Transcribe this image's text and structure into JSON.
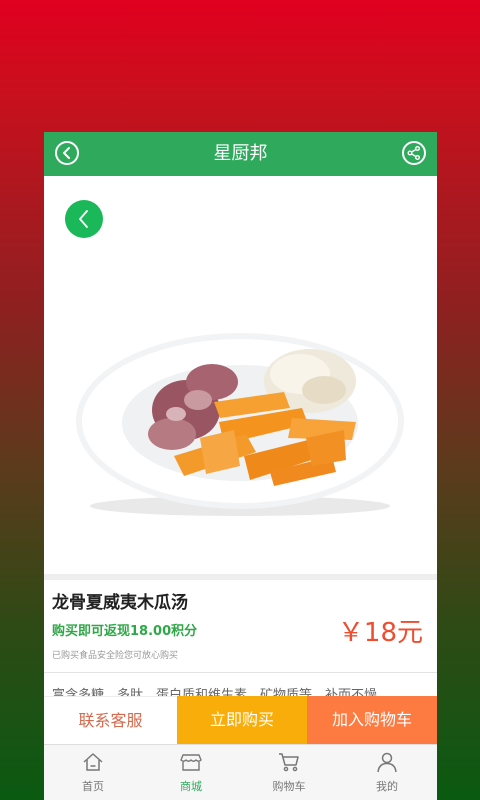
{
  "header": {
    "title": "星厨邦"
  },
  "product": {
    "name": "龙骨夏威夷木瓜汤",
    "rebate": "购买即可返现18.00积分",
    "notice": "已购买食品安全险您可放心购买",
    "price": "￥18元",
    "description": "富含多糖、多肽、蛋白质和维生素、矿物质等，补而不燥"
  },
  "actions": {
    "contact": "联系客服",
    "buy_now": "立即购买",
    "add_to_cart": "加入购物车"
  },
  "tabbar": {
    "items": [
      {
        "label": "首页",
        "icon": "home-icon"
      },
      {
        "label": "商城",
        "icon": "store-icon"
      },
      {
        "label": "购物车",
        "icon": "cart-icon"
      },
      {
        "label": "我的",
        "icon": "user-icon"
      }
    ],
    "active_index": 1
  },
  "colors": {
    "header_green": "#2faa5c",
    "buy_yellow": "#f9ad0a",
    "cart_orange": "#fd7a40",
    "price_red": "#f04c2e",
    "rebate_green": "#2fa748"
  }
}
